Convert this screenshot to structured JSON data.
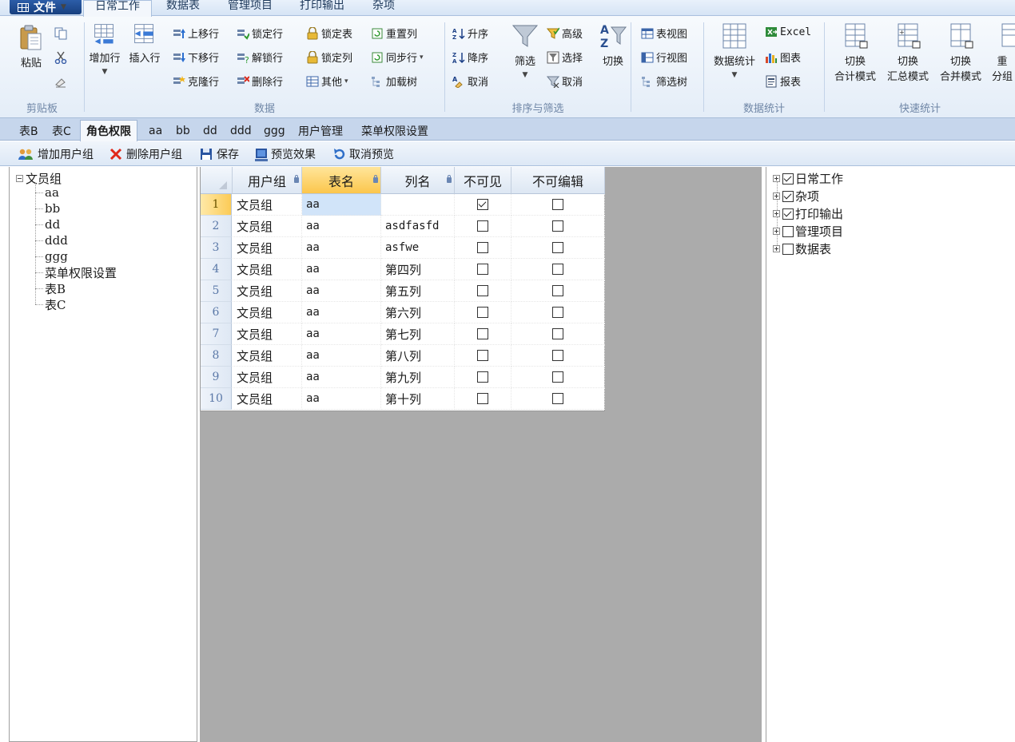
{
  "ribbon_tabs": {
    "file": "文件",
    "tabs": [
      "日常工作",
      "数据表",
      "管理项目",
      "打印输出",
      "杂项"
    ]
  },
  "ribbon": {
    "clipboard": {
      "title": "剪贴板",
      "paste": "粘贴"
    },
    "data": {
      "title": "数据",
      "add_row": "增加行",
      "insert_row": "插入行",
      "move_up": "上移行",
      "move_down": "下移行",
      "clone_row": "克隆行",
      "lock_row": "锁定行",
      "unlock_row": "解锁行",
      "delete_row": "删除行",
      "lock_table": "锁定表",
      "lock_col": "锁定列",
      "other": "其他",
      "reset_col": "重置列",
      "sync_row": "同步行",
      "load_tree": "加载树"
    },
    "sort": {
      "title": "排序与筛选",
      "asc": "升序",
      "desc": "降序",
      "cancel": "取消",
      "filter": "筛选",
      "advanced": "高级",
      "select": "选择",
      "cancel2": "取消",
      "switch": "切换"
    },
    "views": {
      "table_view": "表视图",
      "row_view": "行视图",
      "filter_tree": "筛选树"
    },
    "stats": {
      "title": "数据统计",
      "data_stats": "数据统计",
      "excel": "Excel",
      "chart": "图表",
      "report": "报表"
    },
    "quick": {
      "title": "快速统计",
      "items": [
        {
          "top": "切换",
          "bottom": "合计模式"
        },
        {
          "top": "切换",
          "bottom": "汇总模式"
        },
        {
          "top": "切换",
          "bottom": "合并模式"
        },
        {
          "top": "重",
          "bottom": "分组"
        }
      ]
    }
  },
  "doc_tabs": [
    "表B",
    "表C",
    "角色权限",
    "aa",
    "bb",
    "dd",
    "ddd",
    "ggg",
    "用户管理",
    "菜单权限设置"
  ],
  "toolbar": {
    "add_group": "增加用户组",
    "delete_group": "删除用户组",
    "save": "保存",
    "preview": "预览效果",
    "cancel_preview": "取消预览"
  },
  "left_tree": {
    "root": "文员组",
    "children": [
      "aa",
      "bb",
      "dd",
      "ddd",
      "ggg",
      "菜单权限设置",
      "表B",
      "表C"
    ]
  },
  "grid": {
    "columns": [
      "用户组",
      "表名",
      "列名",
      "不可见",
      "不可编辑"
    ],
    "rows": [
      {
        "n": "1",
        "group": "文员组",
        "table": "aa",
        "col": "",
        "invisible": true,
        "noedit": false
      },
      {
        "n": "2",
        "group": "文员组",
        "table": "aa",
        "col": "asdfasfd",
        "invisible": false,
        "noedit": false
      },
      {
        "n": "3",
        "group": "文员组",
        "table": "aa",
        "col": "asfwe",
        "invisible": false,
        "noedit": false
      },
      {
        "n": "4",
        "group": "文员组",
        "table": "aa",
        "col": "第四列",
        "invisible": false,
        "noedit": false
      },
      {
        "n": "5",
        "group": "文员组",
        "table": "aa",
        "col": "第五列",
        "invisible": false,
        "noedit": false
      },
      {
        "n": "6",
        "group": "文员组",
        "table": "aa",
        "col": "第六列",
        "invisible": false,
        "noedit": false
      },
      {
        "n": "7",
        "group": "文员组",
        "table": "aa",
        "col": "第七列",
        "invisible": false,
        "noedit": false
      },
      {
        "n": "8",
        "group": "文员组",
        "table": "aa",
        "col": "第八列",
        "invisible": false,
        "noedit": false
      },
      {
        "n": "9",
        "group": "文员组",
        "table": "aa",
        "col": "第九列",
        "invisible": false,
        "noedit": false
      },
      {
        "n": "10",
        "group": "文员组",
        "table": "aa",
        "col": "第十列",
        "invisible": false,
        "noedit": false
      }
    ]
  },
  "right_tree": [
    {
      "label": "日常工作",
      "checked": true
    },
    {
      "label": "杂项",
      "checked": true
    },
    {
      "label": "打印输出",
      "checked": true
    },
    {
      "label": "管理项目",
      "checked": false
    },
    {
      "label": "数据表",
      "checked": false
    }
  ]
}
